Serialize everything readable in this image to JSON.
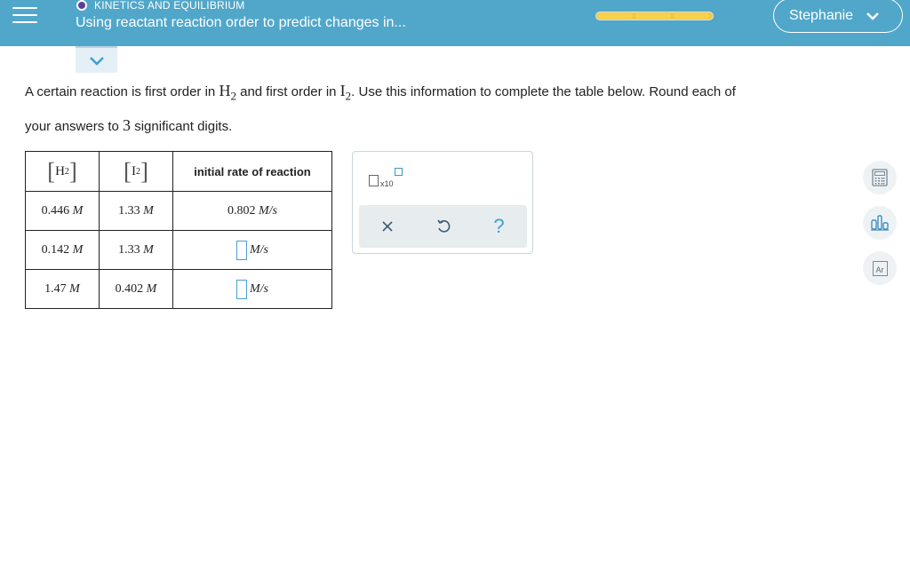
{
  "header": {
    "topic": "KINETICS AND EQUILIBRIUM",
    "lesson_title": "Using reactant reaction order to predict changes in...",
    "user_name": "Stephanie",
    "colors": {
      "bar": "#51a7c9",
      "progress": "#f2c644",
      "topic_dot": "#5b3f99"
    }
  },
  "question": {
    "part1": "A certain reaction is first order in ",
    "h2_letter": "H",
    "h2_sub": "2",
    "part2": " and first order in ",
    "i2_letter": "I",
    "i2_sub": "2",
    "part3": ". Use this information to complete the table below. Round each of",
    "part4": "your answers to ",
    "sig_digits": "3",
    "part5": " significant digits."
  },
  "table": {
    "headers": {
      "h2_letter": "H",
      "h2_sub": "2",
      "i2_letter": "I",
      "i2_sub": "2",
      "rate": "initial rate of reaction"
    },
    "rows": [
      {
        "h2": "0.446",
        "i2": "1.33",
        "unit_conc": "M",
        "rate": "0.802",
        "rate_unit": "M/s"
      },
      {
        "h2": "0.142",
        "i2": "1.33",
        "unit_conc": "M",
        "rate": "",
        "rate_unit": "M/s"
      },
      {
        "h2": "1.47",
        "i2": "0.402",
        "unit_conc": "M",
        "rate": "",
        "rate_unit": "M/s"
      }
    ]
  },
  "tools": {
    "sci_label": "x10",
    "clear_icon": "close-icon",
    "undo_icon": "undo-icon",
    "help_label": "?"
  },
  "side": {
    "icons": [
      "calculator-icon",
      "chart-icon",
      "periodic-table-icon"
    ],
    "periodic_label": "Ar"
  }
}
